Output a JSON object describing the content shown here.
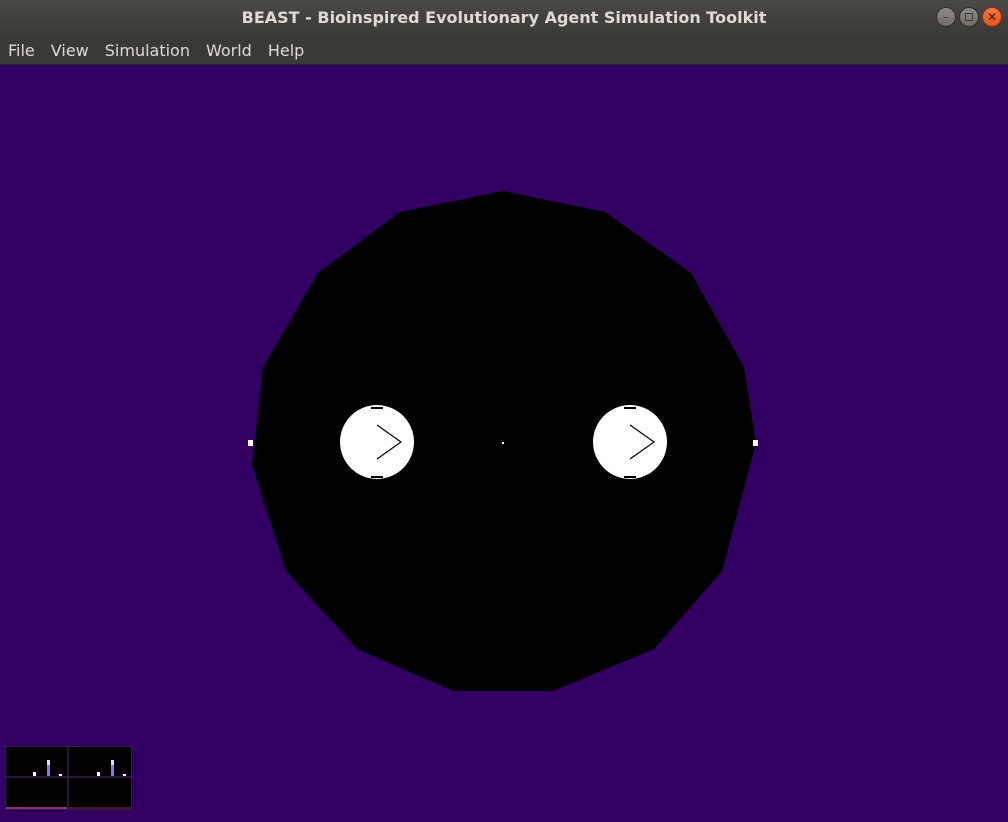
{
  "window": {
    "title": "BEAST - Bioinspired Evolutionary Agent Simulation Toolkit",
    "controls": {
      "minimize_icon": "minimize-icon",
      "maximize_icon": "maximize-icon",
      "close_icon": "close-icon"
    }
  },
  "menu": {
    "items": [
      {
        "label": "File"
      },
      {
        "label": "View"
      },
      {
        "label": "Simulation"
      },
      {
        "label": "World"
      },
      {
        "label": "Help"
      }
    ]
  },
  "world": {
    "background_color": "#320062",
    "arena_color": "#000000",
    "agent_color": "#ffffff",
    "agent_count": 2
  },
  "mini_panels": {
    "count": 2,
    "bar_color": "#7b7bff",
    "baseline_color": "#b04a8f"
  }
}
